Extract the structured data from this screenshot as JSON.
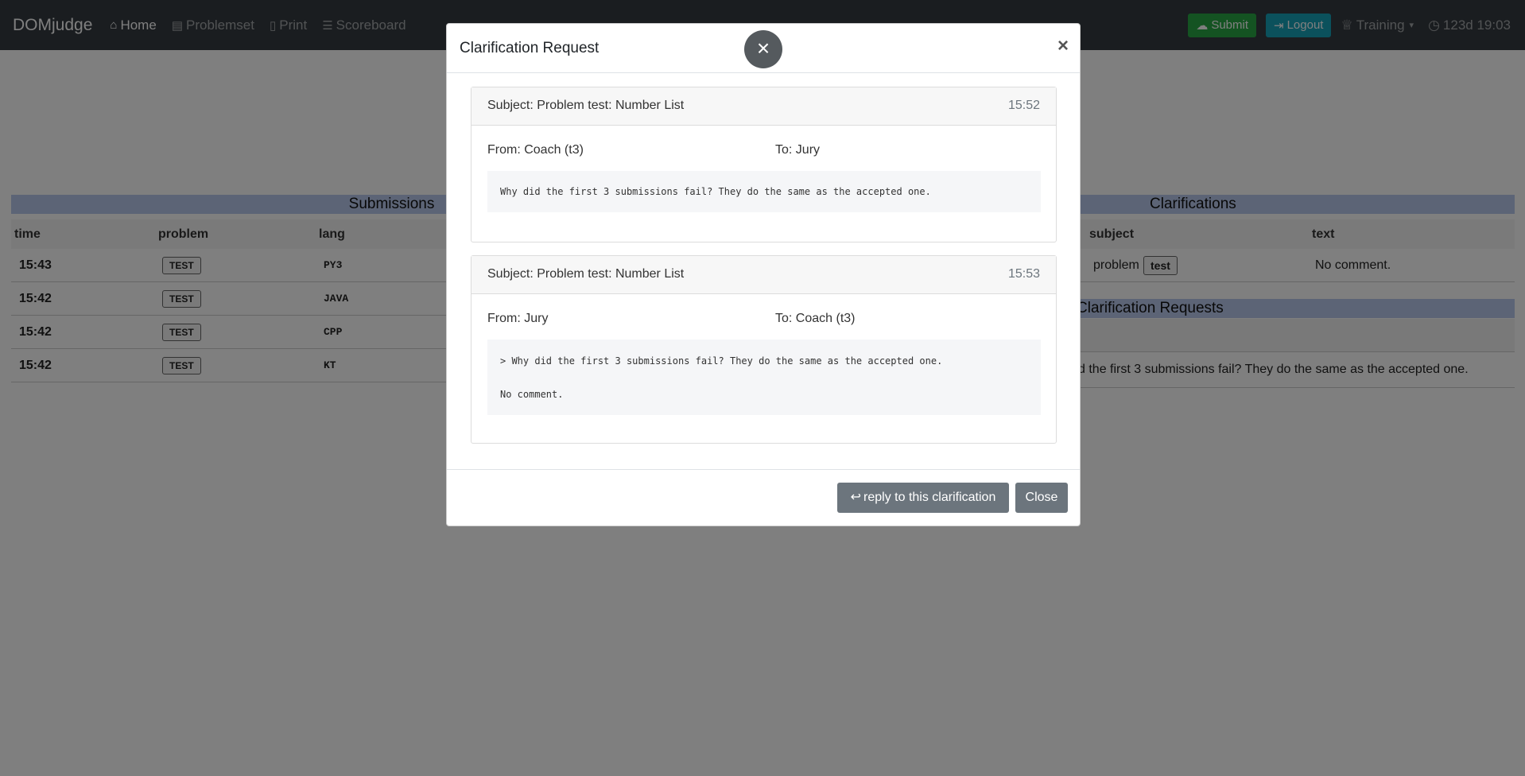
{
  "navbar": {
    "brand": "DOMjudge",
    "items": [
      {
        "label": "Home",
        "icon": "home-icon"
      },
      {
        "label": "Problemset",
        "icon": "book-icon"
      },
      {
        "label": "Print",
        "icon": "file-icon"
      },
      {
        "label": "Scoreboard",
        "icon": "list-icon"
      }
    ],
    "submit_label": "Submit",
    "logout_label": "Logout",
    "contest_label": "Training",
    "clock": "123d 19:03"
  },
  "submissions": {
    "title": "Submissions",
    "columns": [
      "time",
      "problem",
      "lang"
    ],
    "rows": [
      {
        "time": "15:43",
        "problem": "TEST",
        "lang": "PY3"
      },
      {
        "time": "15:42",
        "problem": "TEST",
        "lang": "JAVA"
      },
      {
        "time": "15:42",
        "problem": "TEST",
        "lang": "CPP"
      },
      {
        "time": "15:42",
        "problem": "TEST",
        "lang": "KT"
      }
    ]
  },
  "clarifications": {
    "title": "Clarifications",
    "columns": [
      "subject",
      "text"
    ],
    "rows": [
      {
        "subject_prefix": "problem",
        "subject_badge": "test",
        "text": "No comment."
      }
    ],
    "requests_title": "Clarification Requests",
    "request_text_partial": "d the first 3 submissions fail? They do the same as the accepted one."
  },
  "modal": {
    "title": "Clarification Request",
    "cards": [
      {
        "subject": "Subject: Problem test: Number List",
        "time": "15:52",
        "from": "From: Coach (t3)",
        "to": "To: Jury",
        "body_lines": [
          "Why did the first 3 submissions fail? They do the same as the accepted one."
        ]
      },
      {
        "subject": "Subject: Problem test: Number List",
        "time": "15:53",
        "from": "From: Jury",
        "to": "To: Coach (t3)",
        "body_lines": [
          "> Why did the first 3 submissions fail? They do the same as the accepted one.",
          "No comment."
        ]
      }
    ],
    "reply_label": "reply to this clarification",
    "close_label": "Close"
  }
}
